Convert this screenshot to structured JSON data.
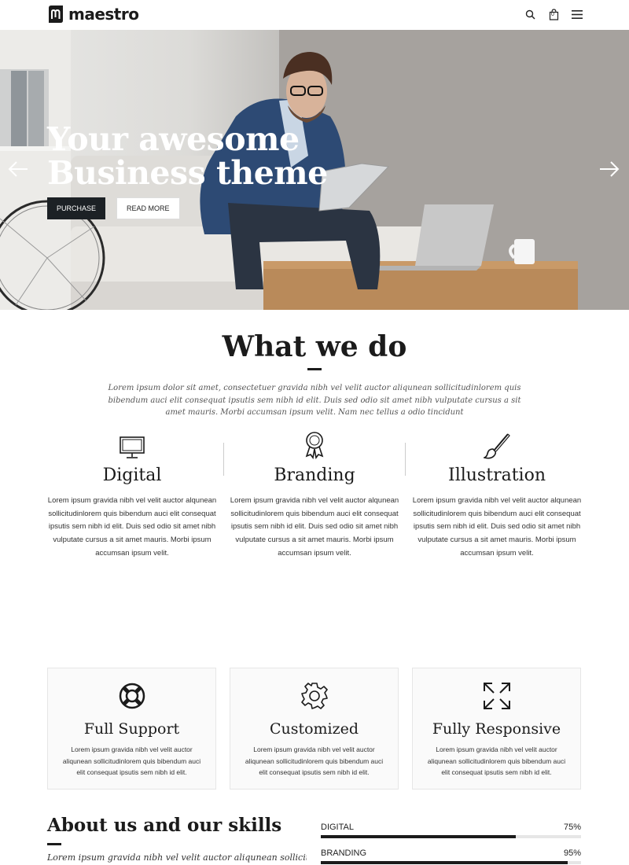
{
  "brand": {
    "name": "maestro"
  },
  "header": {
    "icons": [
      "search-icon",
      "cart-icon",
      "menu-icon"
    ],
    "cart_count": "0"
  },
  "hero": {
    "title_line1": "Your awesome",
    "title_line2": "Business theme",
    "purchase_label": "PURCHASE",
    "read_more_label": "READ MORE"
  },
  "what_we_do": {
    "title": "What we do",
    "intro": "Lorem ipsum dolor sit amet, consectetuer gravida nibh vel velit auctor aliqunean sollicitudinlorem quis bibendum auci elit consequat ipsutis sem nibh id elit. Duis sed odio sit amet nibh vulputate cursus a sit amet mauris. Morbi accumsan ipsum velit. Nam nec tellus a odio tincidunt",
    "services": [
      {
        "icon": "monitor-icon",
        "title": "Digital",
        "text": "Lorem ipsum gravida nibh vel velit auctor alqunean sollicitudinlorem quis bibendum auci elit consequat ipsutis sem nibh id elit. Duis sed odio sit amet nibh vulputate cursus a sit amet mauris. Morbi ipsum accumsan ipsum velit."
      },
      {
        "icon": "award-icon",
        "title": "Branding",
        "text": "Lorem ipsum gravida nibh vel velit auctor alqunean sollicitudinlorem quis bibendum auci elit consequat ipsutis sem nibh id elit. Duis sed odio sit amet nibh vulputate cursus a sit amet mauris. Morbi ipsum accumsan ipsum velit."
      },
      {
        "icon": "brush-icon",
        "title": "Illustration",
        "text": "Lorem ipsum gravida nibh vel velit auctor alqunean sollicitudinlorem quis bibendum auci elit consequat ipsutis sem nibh id elit. Duis sed odio sit amet nibh vulputate cursus a sit amet mauris. Morbi ipsum accumsan ipsum velit."
      }
    ]
  },
  "features": [
    {
      "icon": "lifebuoy-icon",
      "title": "Full Support",
      "text": "Lorem ipsum gravida nibh vel velit auctor aliqunean sollicitudinlorem quis bibendum auci elit consequat ipsutis sem nibh id elit."
    },
    {
      "icon": "gear-icon",
      "title": "Customized",
      "text": "Lorem ipsum gravida nibh vel velit auctor aliqunean sollicitudinlorem quis bibendum auci elit consequat ipsutis sem nibh id elit."
    },
    {
      "icon": "expand-icon",
      "title": "Fully Responsive",
      "text": "Lorem ipsum gravida nibh vel velit auctor aliqunean sollicitudinlorem quis bibendum auci elit consequat ipsutis sem nibh id elit."
    }
  ],
  "about": {
    "title": "About us and our skills",
    "text": "Lorem ipsum gravida nibh vel velit auctor aliqunean sollicitudin",
    "skills": [
      {
        "name": "DIGITAL",
        "percent_label": "75%",
        "value": 0.75
      },
      {
        "name": "BRANDING",
        "percent_label": "95%",
        "value": 0.95
      }
    ]
  },
  "colors": {
    "dark": "#1c2125",
    "accent": "#1b1b1b"
  }
}
